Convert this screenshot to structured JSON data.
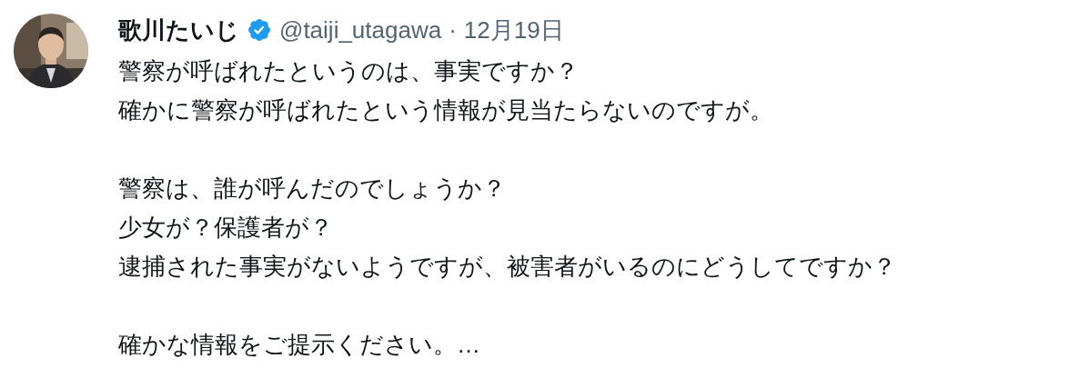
{
  "author": {
    "name": "歌川たいじ",
    "verified": true,
    "handle": "@taiji_utagawa",
    "separator": "·",
    "date": "12月19日"
  },
  "paragraphs": [
    [
      "警察が呼ばれたというのは、事実ですか？",
      "確かに警察が呼ばれたという情報が見当たらないのですが。"
    ],
    [
      "警察は、誰が呼んだのでしょうか？",
      "少女が？保護者が？",
      "逮捕された事実がないようですが、被害者がいるのにどうしてですか？"
    ],
    [
      "確かな情報をご提示ください。…"
    ]
  ]
}
